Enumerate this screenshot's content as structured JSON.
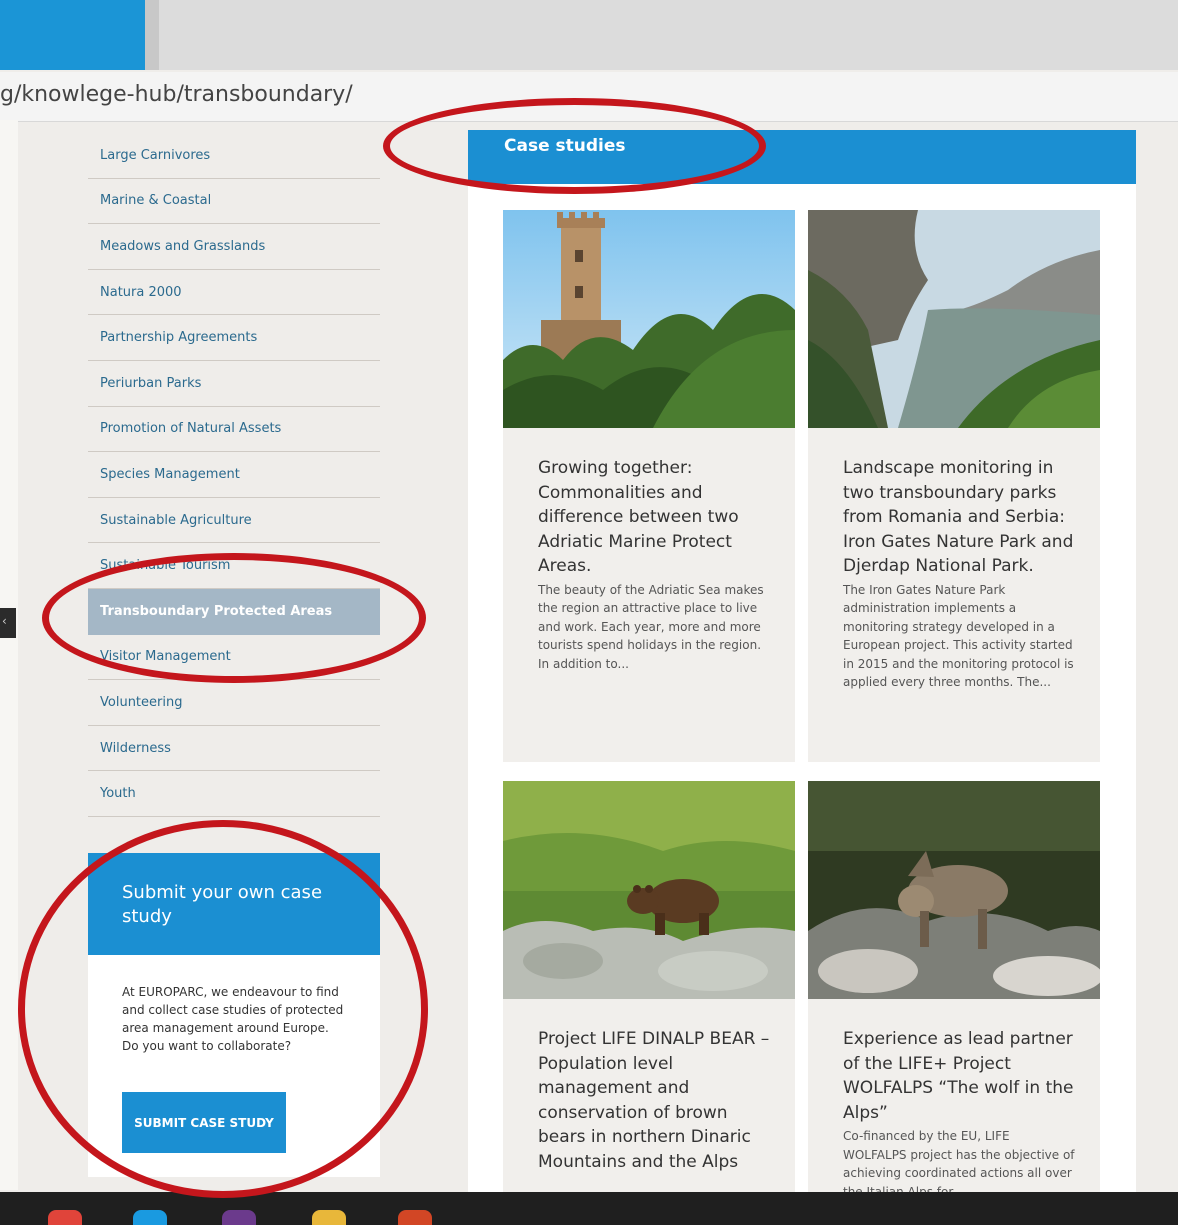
{
  "browser": {
    "url": "g/knowlege-hub/transboundary/"
  },
  "sidebar": {
    "items": [
      {
        "label": "Large Carnivores"
      },
      {
        "label": "Marine & Coastal"
      },
      {
        "label": "Meadows and Grasslands"
      },
      {
        "label": "Natura 2000"
      },
      {
        "label": "Partnership Agreements"
      },
      {
        "label": "Periurban Parks"
      },
      {
        "label": "Promotion of Natural Assets"
      },
      {
        "label": "Species Management"
      },
      {
        "label": "Sustainable Agriculture"
      },
      {
        "label": "Sustainable Tourism"
      },
      {
        "label": "Transboundary Protected Areas"
      },
      {
        "label": "Visitor Management"
      },
      {
        "label": "Volunteering"
      },
      {
        "label": "Wilderness"
      },
      {
        "label": "Youth"
      }
    ],
    "active_label": "Transboundary Protected Areas"
  },
  "submit": {
    "title": "Submit your own case study",
    "text": "At EUROPARC, we endeavour to find and collect case studies of protected area management around Europe. Do you want to collaborate?",
    "button": "SUBMIT CASE STUDY"
  },
  "main": {
    "heading": "Case studies",
    "cards": [
      {
        "title": "Growing together: Commonalities and difference between two Adriatic Marine Protect Areas.",
        "excerpt": "The beauty of the Adriatic Sea makes the region an attractive place to live and work. Each year, more and more tourists spend holidays in the region. In addition to..."
      },
      {
        "title": "Landscape monitoring in two transboundary parks from Romania and Serbia: Iron Gates Nature Park and Djerdap National Park.",
        "excerpt": "The Iron Gates Nature Park administration implements a monitoring strategy developed in a European project. This activity started in 2015 and the monitoring protocol is applied every three months. The..."
      },
      {
        "title": "Project LIFE DINALP BEAR – Population level management and conservation of brown bears in northern Dinaric Mountains and the Alps",
        "excerpt": ""
      },
      {
        "title": "Experience as lead partner of the LIFE+ Project WOLFALPS “The wolf in the Alps”",
        "excerpt": "Co-financed by the EU, LIFE WOLFALPS project has the objective of achieving coordinated actions all over the Italian Alps for..."
      }
    ]
  },
  "colors": {
    "accent_blue": "#1b8fd2",
    "active_item": "#a4b7c6",
    "annotation_red": "#c4161c",
    "link": "#2b6a8e"
  }
}
